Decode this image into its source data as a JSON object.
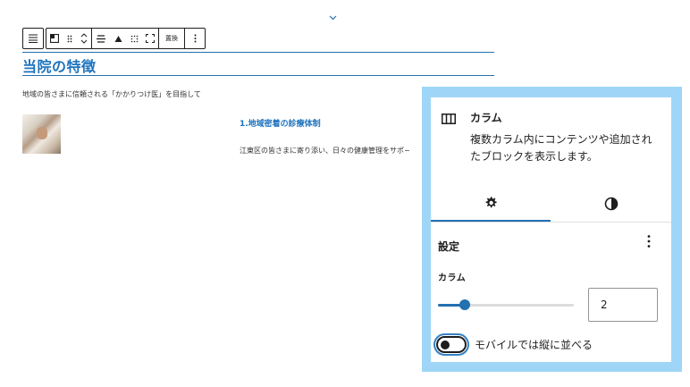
{
  "toolbar": {
    "replace_label": "置換"
  },
  "content": {
    "heading": "当院の特徴",
    "paragraph": "地域の皆さまに信頼される「かかりつけ医」を目指して",
    "column_title": "1.地域密着の診療体制",
    "column_text": "江東区の皆さまに寄り添い、日々の健康管理をサポ−"
  },
  "sidebar": {
    "block_title": "カラム",
    "block_description": "複数カラム内にコンテンツや追加されたブロックを表示します。",
    "tabs": [
      {
        "icon": "gear-icon",
        "active": true
      },
      {
        "icon": "contrast-icon",
        "active": false
      }
    ],
    "section_title": "設定",
    "columns_label": "カラム",
    "columns_value": "2",
    "slider_fraction": 0.2,
    "mobile_stack_label": "モバイルでは縦に並べる",
    "mobile_stack_on": false
  },
  "colors": {
    "accent": "#2271b1",
    "heading": "#1e73be",
    "callout_frame": "#9fd6f8"
  }
}
